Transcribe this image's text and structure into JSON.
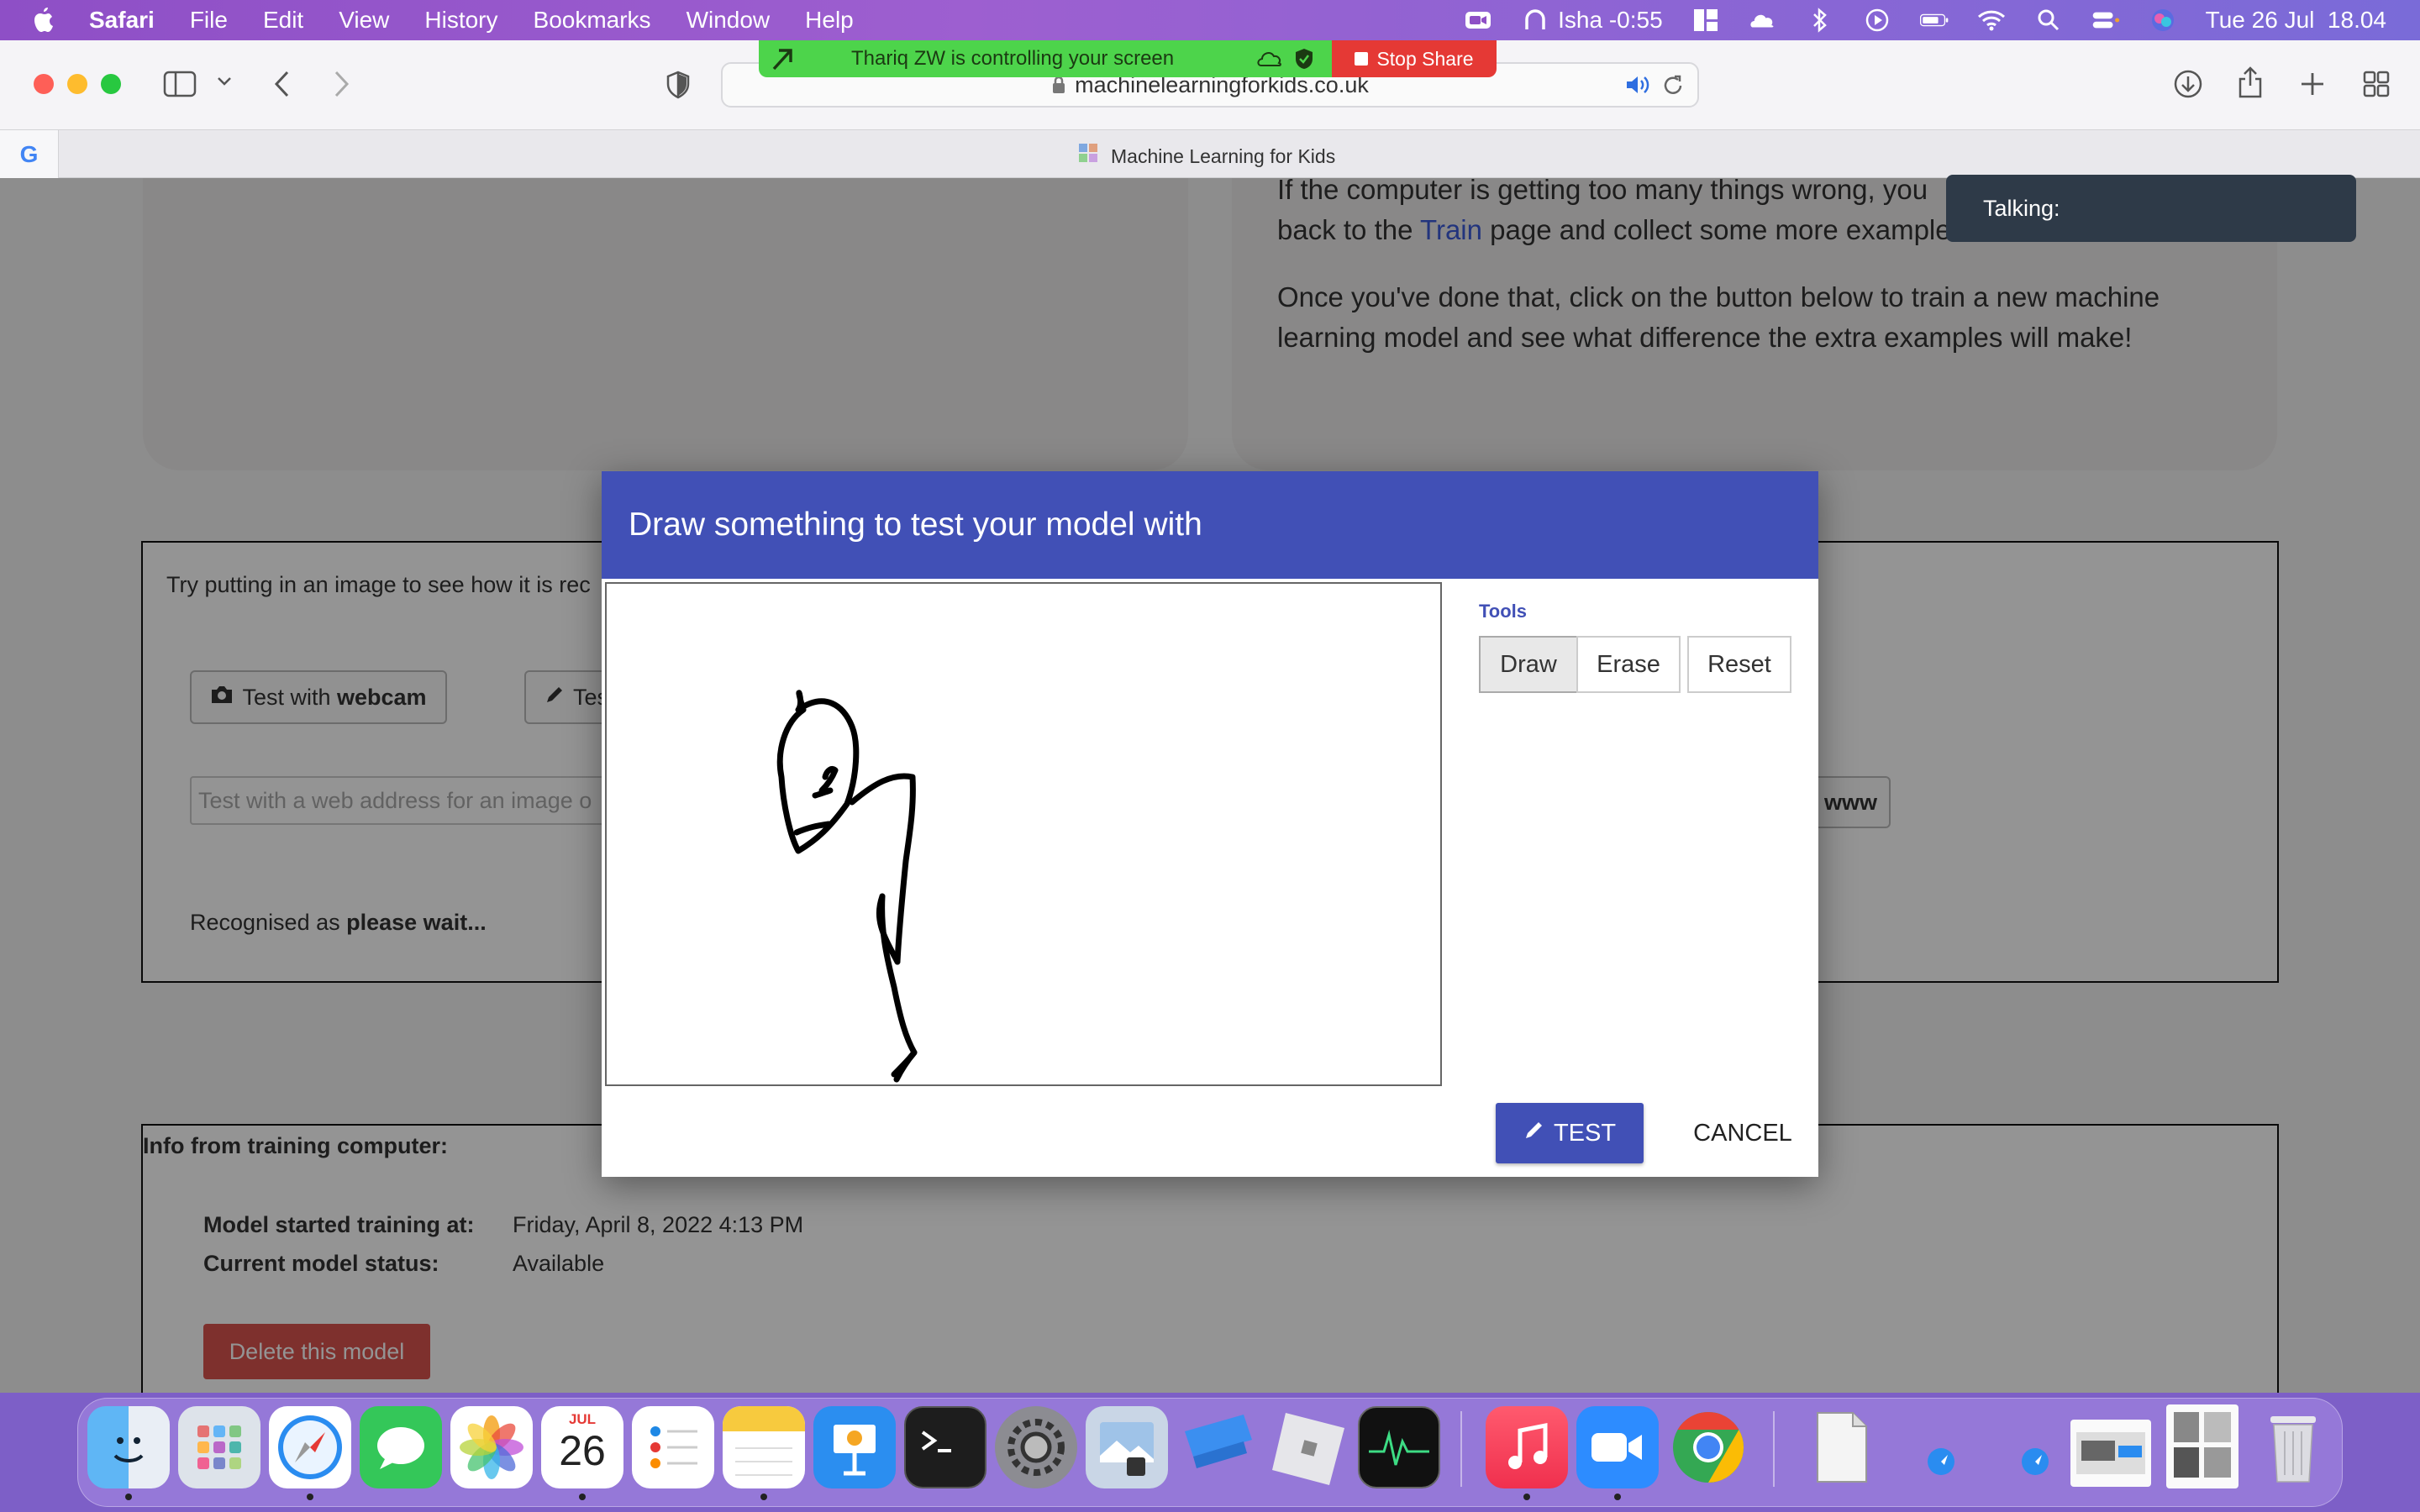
{
  "menubar": {
    "app_name": "Safari",
    "items": [
      "File",
      "Edit",
      "View",
      "History",
      "Bookmarks",
      "Window",
      "Help"
    ],
    "status_user": "Isha -0:55",
    "clock": "Tue 26 Jul  18.04"
  },
  "share_banner": {
    "message": "Thariq ZW is controlling your screen",
    "stop_label": "Stop Share"
  },
  "browser": {
    "url": "machinelearningforkids.co.uk",
    "tab_title": "Machine Learning for Kids",
    "tab_favicon_letter": "G"
  },
  "toast": {
    "label": "Talking:"
  },
  "page": {
    "hint_line1": "If the computer is getting too many things wrong, you",
    "hint_line2_before": "back to the ",
    "hint_line2_link": "Train",
    "hint_line2_after": " page and collect some more examples",
    "hint_para2_line1": "Once you've done that, click on the button below to train a new machine",
    "hint_para2_line2": "learning model and see what difference the extra examples will make!",
    "try_text": "Try putting in an image to see how it is rec",
    "webcam_btn_prefix": "Test with ",
    "webcam_btn_bold": "webcam",
    "draw_btn_partial": "Tes",
    "url_input_placeholder": "Test with a web address for an image o",
    "www_btn_partial": "www",
    "recognised_prefix": "Recognised as ",
    "recognised_value": "please wait...",
    "info_title": "Info from training computer:",
    "model_started_label": "Model started training at:",
    "model_started_value": "Friday, April 8, 2022 4:13 PM",
    "model_status_label": "Current model status:",
    "model_status_value": "Available",
    "delete_btn": "Delete this model"
  },
  "dialog": {
    "title": "Draw something to test your model with",
    "tools_label": "Tools",
    "tools": [
      "Draw",
      "Erase",
      "Reset"
    ],
    "active_tool": "Draw",
    "test_label": "TEST",
    "cancel_label": "CANCEL"
  },
  "dock": {
    "calendar_month": "JUL",
    "calendar_day": "26",
    "apps": [
      "finder-icon",
      "launchpad-icon",
      "safari-icon",
      "messages-icon",
      "photos-icon",
      "calendar-icon",
      "reminders-icon",
      "notes-icon",
      "keynote-icon",
      "terminal-icon",
      "system-preferences-icon",
      "preview-icon",
      "app-store-like-icon",
      "roblox-icon",
      "activity-monitor-icon",
      "music-icon",
      "zoom-icon",
      "chrome-icon",
      "document-icon",
      "trash-icon"
    ]
  },
  "colors": {
    "dialog_header": "#4150b6",
    "accent_link": "#3c5bd8",
    "share_green": "#4dd44b",
    "stop_red": "#e53935",
    "delete_red": "#d9534f"
  }
}
